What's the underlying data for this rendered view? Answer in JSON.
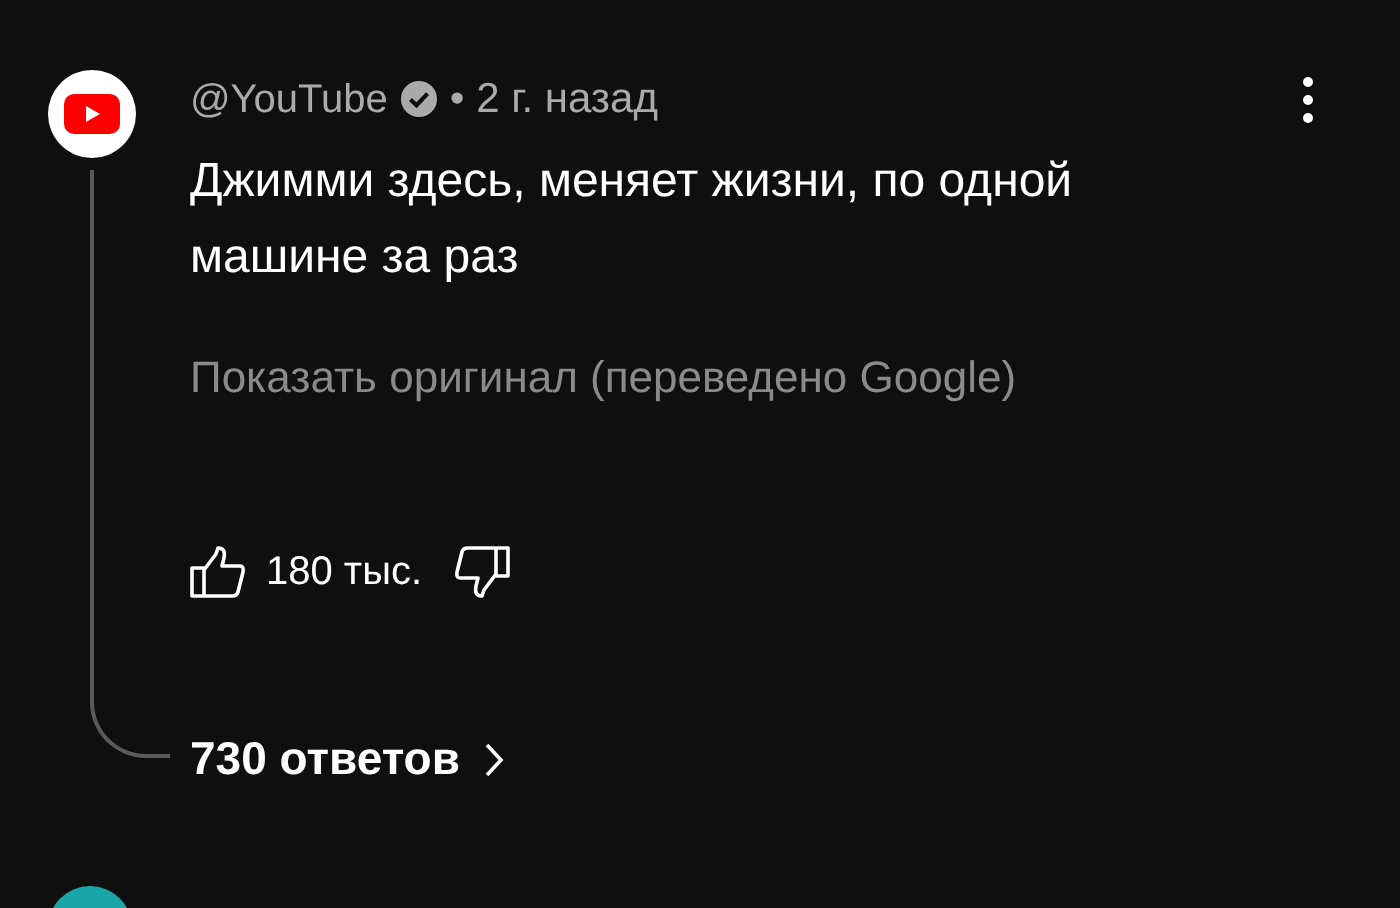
{
  "comment": {
    "author": "@YouTube",
    "verified": true,
    "time": "• 2 г. назад",
    "text": "Джимми здесь, меняет жизни, по одной машине за раз",
    "translate_link": "Показать оригинал (переведено Google)",
    "likes": "180 тыс.",
    "replies": "730 ответов"
  }
}
